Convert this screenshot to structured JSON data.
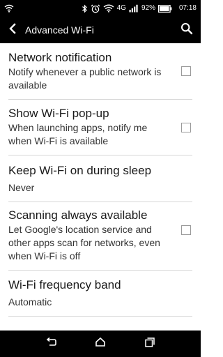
{
  "status_bar": {
    "network_type": "4G",
    "battery_percent": "92%",
    "time": "07:18",
    "icons": [
      "wifi-icon",
      "bluetooth-icon",
      "alarm-icon",
      "wifi-signal-icon",
      "cell-signal-icon",
      "battery-icon"
    ]
  },
  "app_bar": {
    "title": "Advanced Wi-Fi"
  },
  "settings": [
    {
      "title": "Network notification",
      "summary": "Notify whenever a public network is available",
      "has_checkbox": true,
      "checked": false
    },
    {
      "title": "Show Wi-Fi pop-up",
      "summary": "When launching apps, notify me when Wi-Fi is available",
      "has_checkbox": true,
      "checked": false
    },
    {
      "title": "Keep Wi-Fi on during sleep",
      "summary": "Never",
      "has_checkbox": false
    },
    {
      "title": "Scanning always available",
      "summary": "Let Google's location service and other apps scan for networks, even when Wi-Fi is off",
      "has_checkbox": true,
      "checked": false
    },
    {
      "title": "Wi-Fi frequency band",
      "summary": "Automatic",
      "has_checkbox": false
    }
  ],
  "nav_bar": {
    "icons": [
      "back-icon",
      "home-icon",
      "recents-icon"
    ]
  }
}
